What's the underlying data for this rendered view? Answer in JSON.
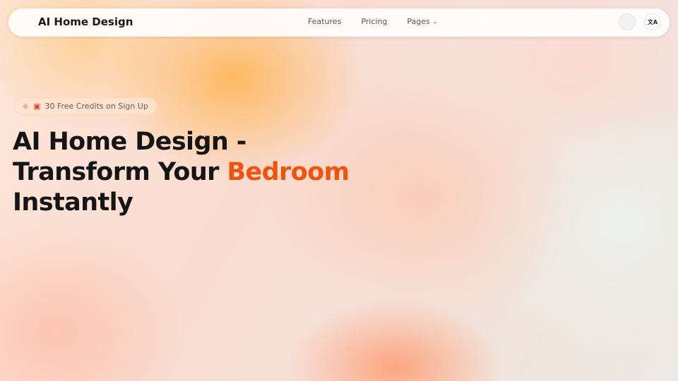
{
  "navbar": {
    "brand": "AI Home Design",
    "links": [
      {
        "label": "Features"
      },
      {
        "label": "Pricing"
      },
      {
        "label": "Pages"
      }
    ],
    "icons": {
      "avatar": "avatar-placeholder",
      "language": "translate-icon"
    },
    "language_glyph": "文A"
  },
  "badge": {
    "icon": "sparkle-icon",
    "gift_icon": "gift-icon",
    "text": "30 Free Credits on Sign Up"
  },
  "hero": {
    "line1": "AI Home Design -",
    "line2_prefix": "Transform Your ",
    "line2_accent": "Bedroom",
    "line3": "Instantly"
  },
  "colors": {
    "accent": "#f0530c",
    "text": "#151515"
  }
}
